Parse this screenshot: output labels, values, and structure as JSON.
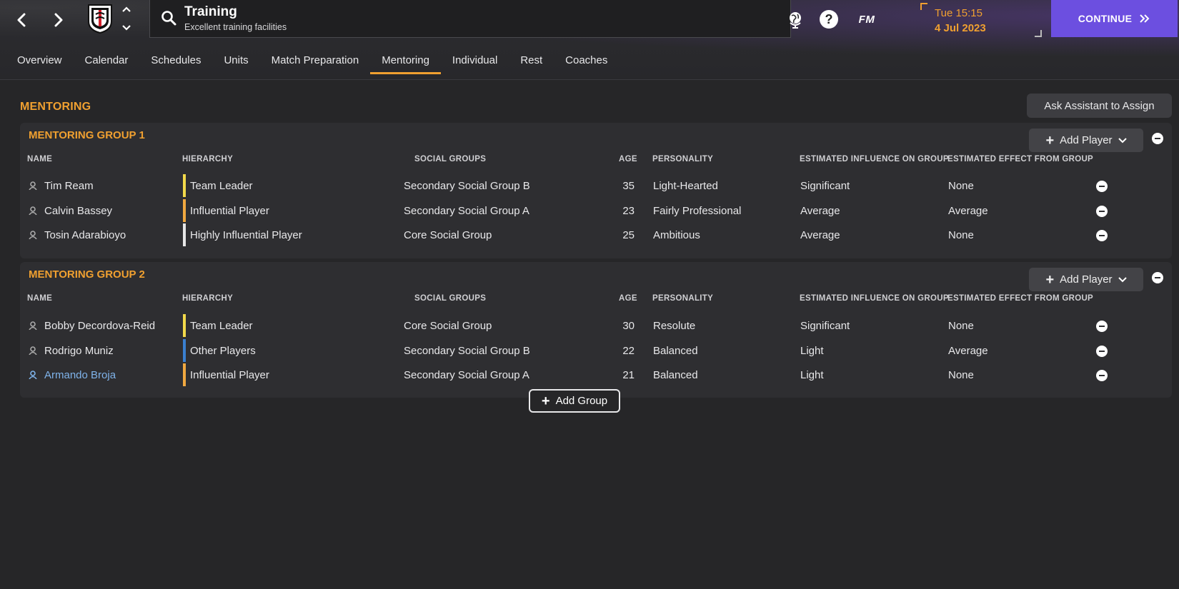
{
  "header": {
    "title": "Training",
    "subtitle": "Excellent training facilities",
    "fm_logo": "FM",
    "help_glyph": "?",
    "time": "Tue 15:15",
    "date": "4 Jul 2023",
    "continue_label": "CONTINUE",
    "icons": [
      "back-arrow-icon",
      "forward-arrow-icon",
      "club-crest-icon",
      "search-icon",
      "globe-icon",
      "help-icon"
    ]
  },
  "tabs": [
    "Overview",
    "Calendar",
    "Schedules",
    "Units",
    "Match Preparation",
    "Mentoring",
    "Individual",
    "Rest",
    "Coaches"
  ],
  "active_tab": "Mentoring",
  "main": {
    "section_title": "MENTORING",
    "assistant_button": "Ask Assistant to Assign",
    "add_group_label": "Add Group"
  },
  "columns": {
    "name": "NAME",
    "hierarchy": "HIERARCHY",
    "social": "SOCIAL GROUPS",
    "age": "AGE",
    "personality": "PERSONALITY",
    "influence": "ESTIMATED INFLUENCE ON GROUP",
    "effect": "ESTIMATED EFFECT FROM GROUP"
  },
  "groups": [
    {
      "title": "MENTORING GROUP 1",
      "add_player_label": "Add Player",
      "players": [
        {
          "name": "Tim Ream",
          "hierarchy": "Team Leader",
          "hierarchy_color": "#f2d94a",
          "social": "Secondary Social Group B",
          "age": "35",
          "personality": "Light-Hearted",
          "influence": "Significant",
          "effect": "None"
        },
        {
          "name": "Calvin Bassey",
          "hierarchy": "Influential Player",
          "hierarchy_color": "#f0a840",
          "social": "Secondary Social Group A",
          "age": "23",
          "personality": "Fairly Professional",
          "influence": "Average",
          "effect": "Average"
        },
        {
          "name": "Tosin Adarabioyo",
          "hierarchy": "Highly Influential Player",
          "hierarchy_color": "#e6e6e6",
          "social": "Core Social Group",
          "age": "25",
          "personality": "Ambitious",
          "influence": "Average",
          "effect": "None"
        }
      ]
    },
    {
      "title": "MENTORING GROUP 2",
      "add_player_label": "Add Player",
      "players": [
        {
          "name": "Bobby Decordova-Reid",
          "hierarchy": "Team Leader",
          "hierarchy_color": "#f2d94a",
          "social": "Core Social Group",
          "age": "30",
          "personality": "Resolute",
          "influence": "Significant",
          "effect": "None"
        },
        {
          "name": "Rodrigo Muniz",
          "hierarchy": "Other Players",
          "hierarchy_color": "#3a7fd0",
          "social": "Secondary Social Group B",
          "age": "22",
          "personality": "Balanced",
          "influence": "Light",
          "effect": "Average"
        },
        {
          "name": "Armando Broja",
          "hierarchy": "Influential Player",
          "hierarchy_color": "#f0a840",
          "social": "Secondary Social Group A",
          "age": "21",
          "personality": "Balanced",
          "influence": "Light",
          "effect": "None",
          "link": true
        }
      ]
    }
  ],
  "colors": {
    "accent": "#f0a030",
    "continue": "#6c4fe0",
    "link": "#7fb3ea",
    "background": "#262628",
    "panel": "#2e2e31"
  }
}
